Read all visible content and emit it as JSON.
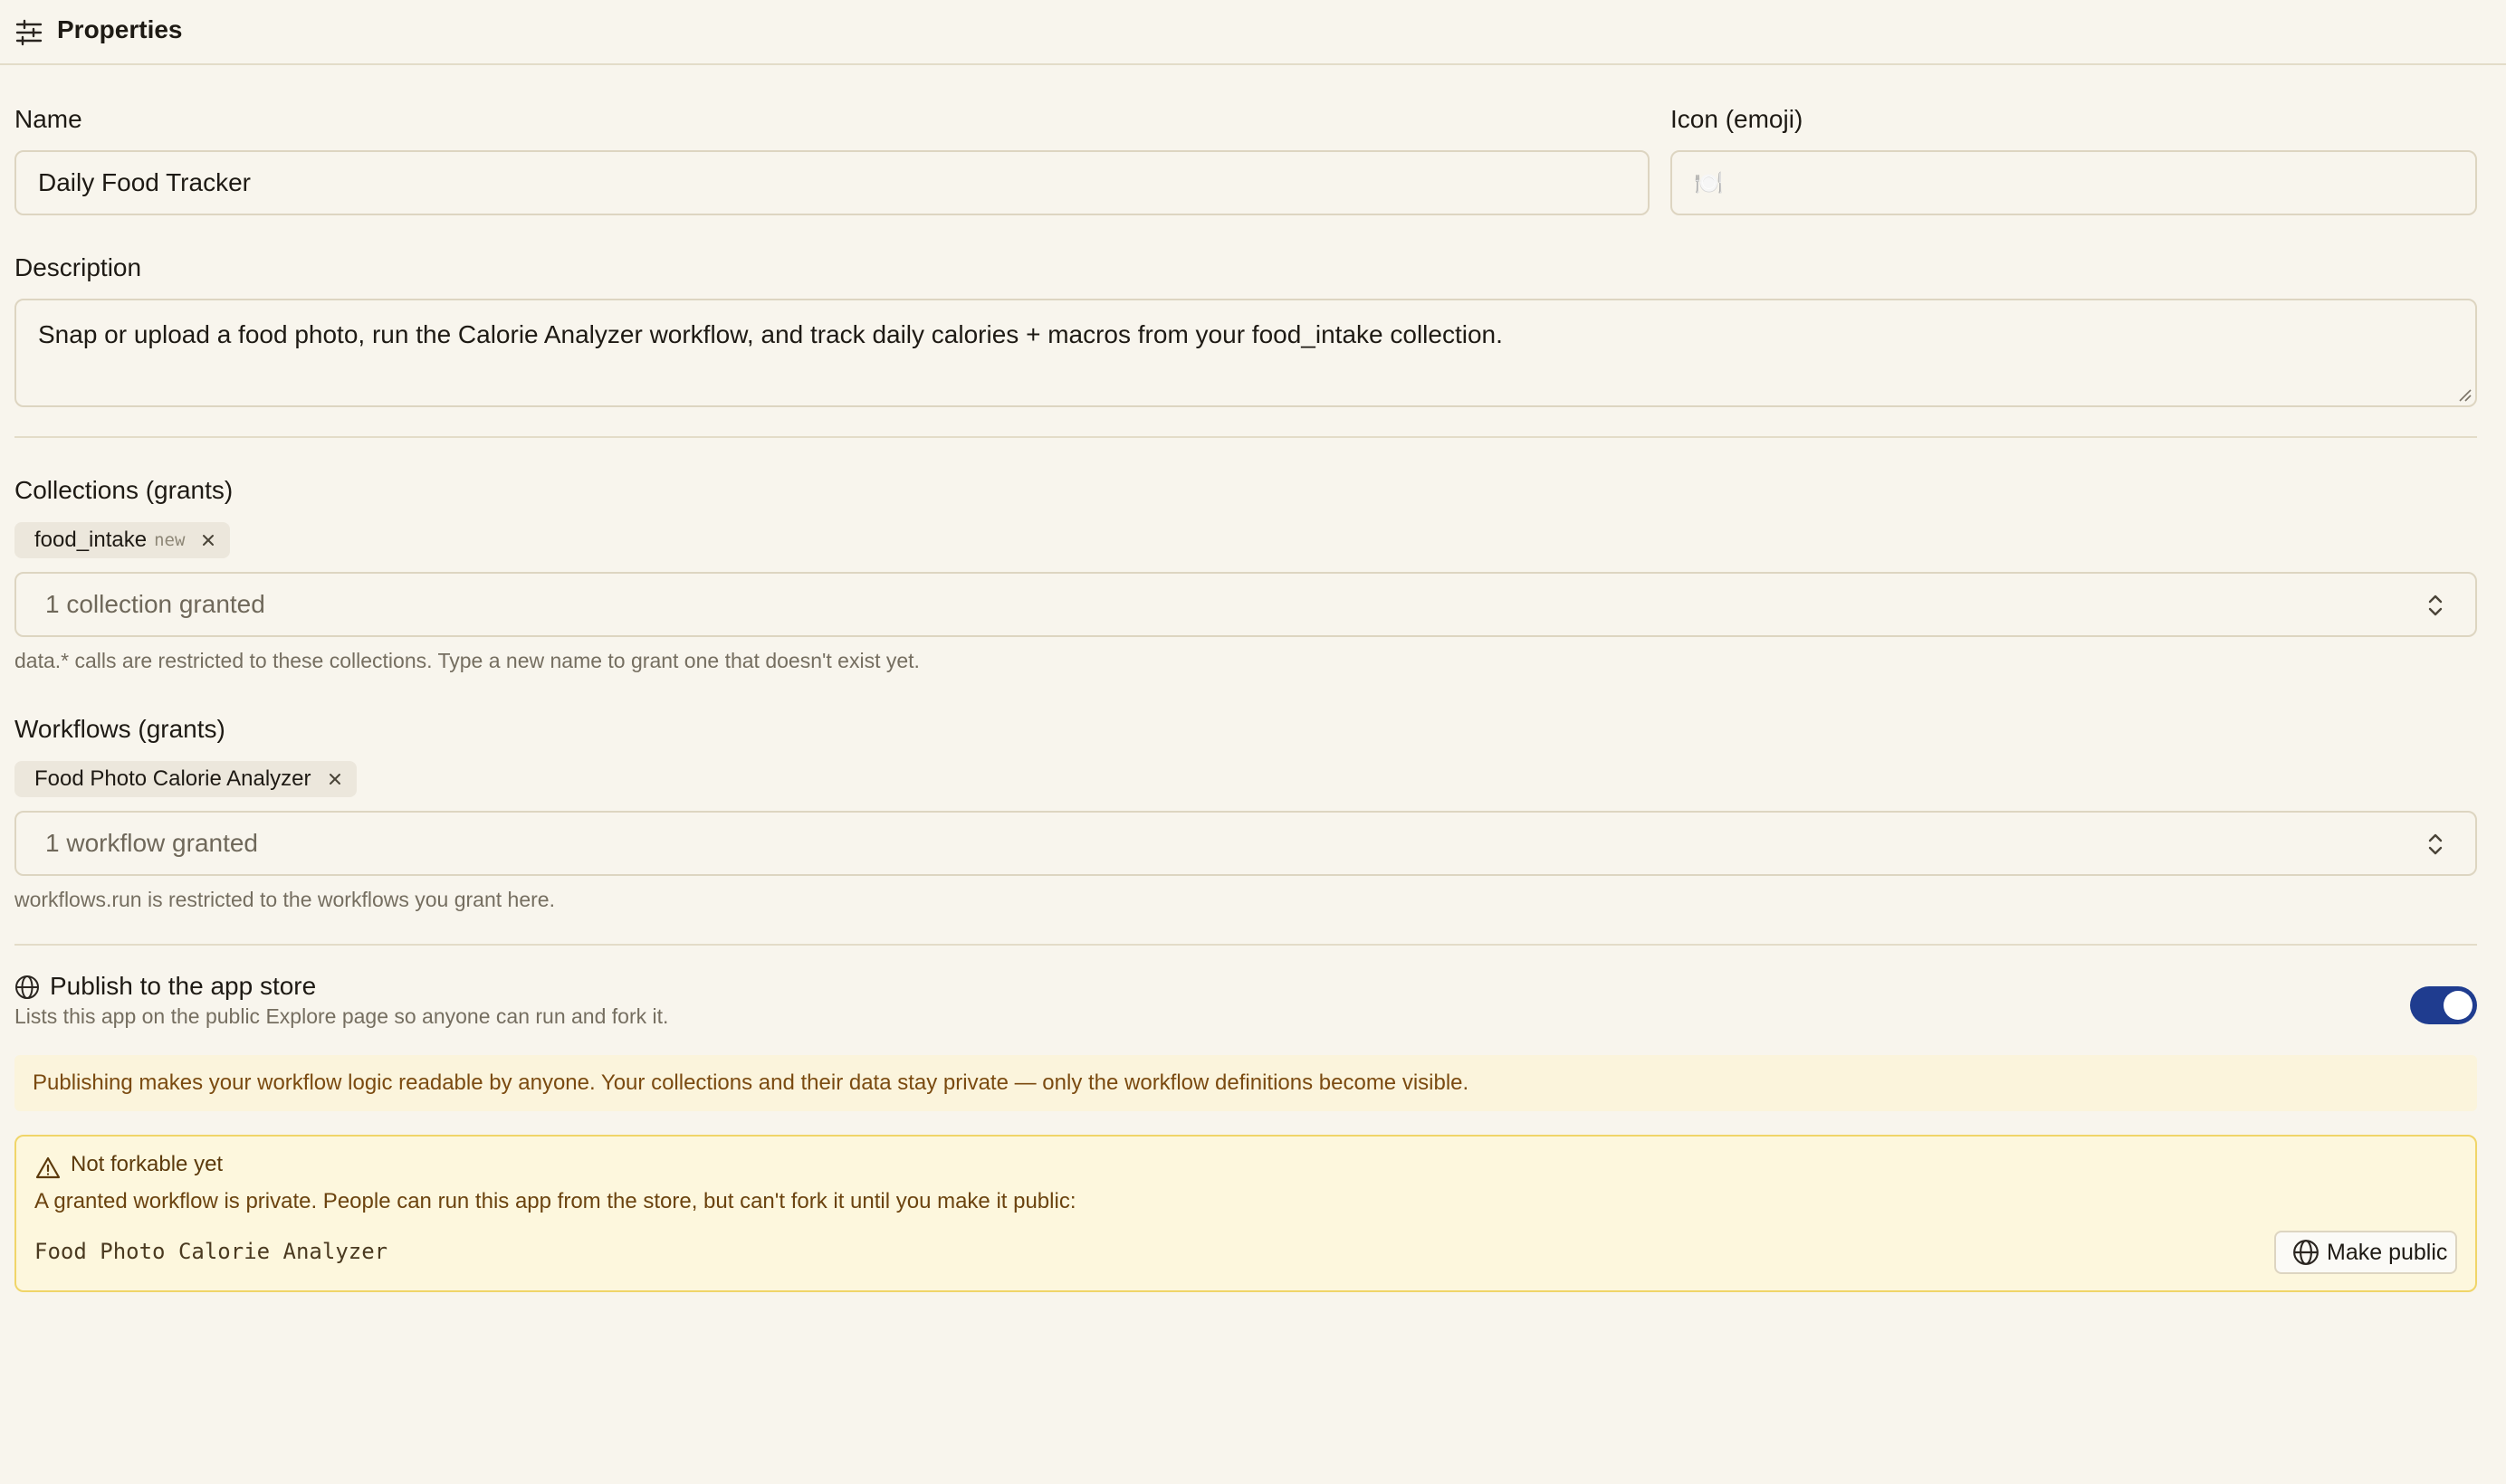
{
  "header": {
    "title": "Properties",
    "icon": "sliders-icon"
  },
  "form": {
    "name_label": "Name",
    "name_value": "Daily Food Tracker",
    "icon_label": "Icon (emoji)",
    "icon_value": "🍽️",
    "description_label": "Description",
    "description_value": "Snap or upload a food photo, run the Calorie Analyzer workflow, and track daily calories + macros from your food_intake collection."
  },
  "collections": {
    "label": "Collections (grants)",
    "chips": [
      {
        "name": "food_intake",
        "tag": "new"
      }
    ],
    "select_value": "1 collection granted",
    "hint": "data.* calls are restricted to these collections. Type a new name to grant one that doesn't exist yet."
  },
  "workflows": {
    "label": "Workflows (grants)",
    "chips": [
      {
        "name": "Food Photo Calorie Analyzer"
      }
    ],
    "select_value": "1 workflow granted",
    "hint": "workflows.run is restricted to the workflows you grant here."
  },
  "publish": {
    "title": "Publish to the app store",
    "subtitle": "Lists this app on the public Explore page so anyone can run and fork it.",
    "enabled": true,
    "toggle_color": "#1f3c8f",
    "info": "Publishing makes your workflow logic readable by anyone. Your collections and their data stay private — only the workflow definitions become visible."
  },
  "warning": {
    "title": "Not forkable yet",
    "description": "A granted workflow is private. People can run this app from the store, but can't fork it until you make it public:",
    "workflow_name": "Food Photo Calorie Analyzer",
    "button_label": "Make public"
  }
}
